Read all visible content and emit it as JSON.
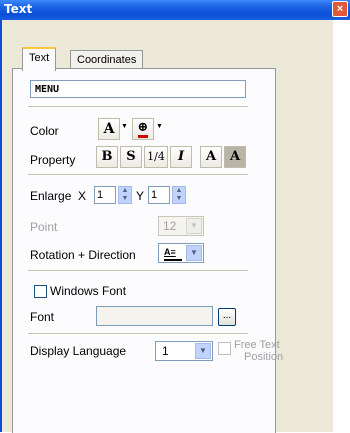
{
  "window": {
    "title": "Text",
    "close_glyph": "×"
  },
  "tabs": [
    {
      "label": "Text",
      "active": true
    },
    {
      "label": "Coordinates",
      "active": false
    }
  ],
  "text_field": {
    "value": "MENU"
  },
  "color": {
    "label": "Color",
    "font_color_glyph": "A",
    "fill_glyph": "⊕"
  },
  "property": {
    "label": "Property",
    "bold": "B",
    "shadow": "S",
    "quarter": "1/4",
    "italic": "I",
    "normal": "A",
    "inverse": "A"
  },
  "enlarge": {
    "label": "Enlarge",
    "x_label": "X",
    "x_value": "1",
    "y_label": "Y",
    "y_value": "1"
  },
  "point": {
    "label": "Point",
    "value": "12"
  },
  "rotation": {
    "label": "Rotation + Direction"
  },
  "windows_font": {
    "label": "Windows Font",
    "checked": false
  },
  "font": {
    "label": "Font",
    "value": "",
    "browse": "..."
  },
  "display_language": {
    "label": "Display Language",
    "value": "1"
  },
  "free_text": {
    "label_line1": "Free Text",
    "label_line2": "Position"
  }
}
